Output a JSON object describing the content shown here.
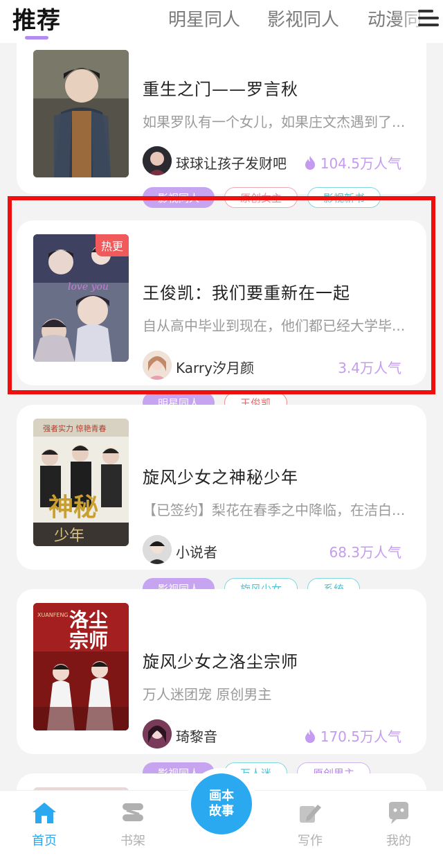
{
  "top_tabs": {
    "active": "推荐",
    "items": [
      "明星同人",
      "影视同人",
      "动漫同"
    ]
  },
  "stories": [
    {
      "title": "重生之门——罗言秋",
      "desc": "如果罗队有一个女儿，如果庄文杰遇到了...",
      "author": "球球让孩子发财吧",
      "popularity": "104.5万人气",
      "tags": [
        "影视同人",
        "原创女主",
        "影视新书"
      ]
    },
    {
      "badge": "热更",
      "title": "王俊凯：我们要重新在一起",
      "desc": "自从高中毕业到现在，他们都已经大学毕...",
      "author": "Karry汐月颜",
      "popularity": "3.4万人气",
      "tags": [
        "明星同人",
        "王俊凯"
      ]
    },
    {
      "title": "旋风少女之神秘少年",
      "desc": "【已签约】梨花在春季之中降临，在洁白...",
      "author": "小说者",
      "popularity": "68.3万人气",
      "tags": [
        "影视同人",
        "旋风少女",
        "系统"
      ]
    },
    {
      "title": "旋风少女之洛尘宗师",
      "desc": "万人迷团宠 原创男主",
      "author": "琦黎音",
      "popularity": "170.5万人气",
      "tags": [
        "影视同人",
        "万人迷",
        "原创男主"
      ]
    }
  ],
  "bottom_nav": {
    "home": "首页",
    "shelf": "书架",
    "center_line1": "画本",
    "center_line2": "故事",
    "write": "写作",
    "mine": "我的"
  },
  "colors": {
    "accent_purple": "#c7a4f0",
    "nav_blue": "#2aa8f0",
    "highlight_red": "#ee0f0f",
    "hot_badge": "#f05a5a"
  }
}
